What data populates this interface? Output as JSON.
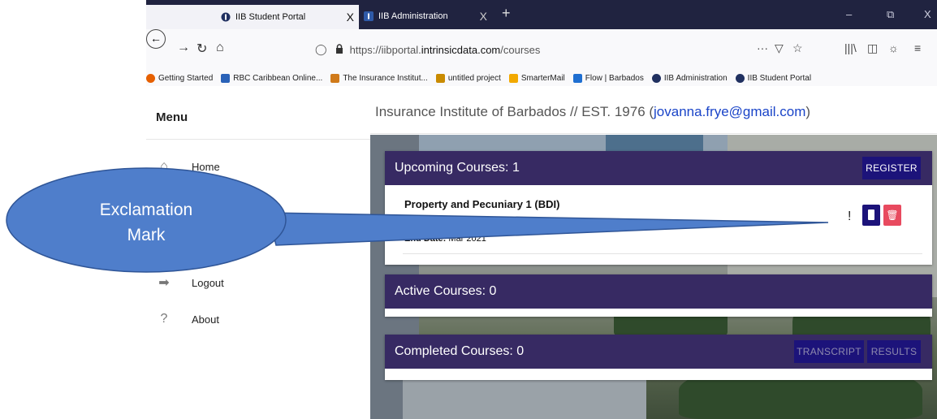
{
  "browser": {
    "tabs": [
      {
        "title": "IIB Student Portal",
        "active": true
      },
      {
        "title": "IIB Administration",
        "active": false
      }
    ],
    "tab_close": "X",
    "new_tab": "+",
    "window_controls": {
      "minimize": "–",
      "restore": "⧉",
      "close": "X"
    },
    "url_prefix": "https://iibportal.",
    "url_domain": "intrinsicdata.com",
    "url_path": "/courses",
    "url_menu": "···",
    "bookmarks": [
      {
        "label": "Getting Started",
        "color": "#e66000"
      },
      {
        "label": "RBC Caribbean Online...",
        "color": "#2a62b8"
      },
      {
        "label": "The Insurance Institut...",
        "color": "#d07a1a"
      },
      {
        "label": "untitled project",
        "color": "#c98b00"
      },
      {
        "label": "SmarterMail",
        "color": "#f2a900"
      },
      {
        "label": "Flow | Barbados",
        "color": "#1f6fd1"
      },
      {
        "label": "IIB Administration",
        "color": "#203060"
      },
      {
        "label": "IIB Student Portal",
        "color": "#203060"
      }
    ]
  },
  "sidebar": {
    "title": "Menu",
    "items": [
      {
        "label": "Home",
        "icon": "home-icon",
        "glyph": "⌂"
      },
      {
        "label": "Logout",
        "icon": "logout-icon",
        "glyph": "➡"
      },
      {
        "label": "About",
        "icon": "help-icon",
        "glyph": "?"
      }
    ]
  },
  "header": {
    "title": "Insurance Institute of Barbados // EST. 1976 (",
    "email": "jovanna.frye@gmail.com",
    "title_end": ")"
  },
  "upcoming": {
    "heading": "Upcoming Courses: 1",
    "register_label": "REGISTER",
    "course": {
      "name": "Property and Pecuniary 1 (BDI)",
      "end_date_label": "End Date:",
      "end_date": "Mar 2021",
      "warning": "!"
    }
  },
  "active": {
    "heading": "Active Courses: 0"
  },
  "completed": {
    "heading": "Completed Courses: 0",
    "transcript_label": "TRANSCRIPT",
    "results_label": "RESULTS"
  },
  "callout": {
    "line1": "Exclamation",
    "line2": "Mark",
    "color": "#4f7ecb"
  }
}
